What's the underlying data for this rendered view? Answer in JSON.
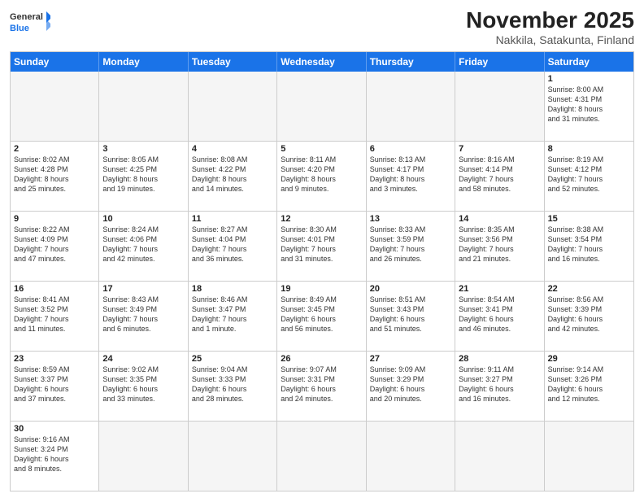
{
  "logo": {
    "general": "General",
    "blue": "Blue"
  },
  "title": "November 2025",
  "subtitle": "Nakkila, Satakunta, Finland",
  "days": [
    "Sunday",
    "Monday",
    "Tuesday",
    "Wednesday",
    "Thursday",
    "Friday",
    "Saturday"
  ],
  "rows": [
    [
      {
        "day": "",
        "info": "",
        "empty": true
      },
      {
        "day": "",
        "info": "",
        "empty": true
      },
      {
        "day": "",
        "info": "",
        "empty": true
      },
      {
        "day": "",
        "info": "",
        "empty": true
      },
      {
        "day": "",
        "info": "",
        "empty": true
      },
      {
        "day": "",
        "info": "",
        "empty": true
      },
      {
        "day": "1",
        "info": "Sunrise: 8:00 AM\nSunset: 4:31 PM\nDaylight: 8 hours\nand 31 minutes."
      }
    ],
    [
      {
        "day": "2",
        "info": "Sunrise: 8:02 AM\nSunset: 4:28 PM\nDaylight: 8 hours\nand 25 minutes."
      },
      {
        "day": "3",
        "info": "Sunrise: 8:05 AM\nSunset: 4:25 PM\nDaylight: 8 hours\nand 19 minutes."
      },
      {
        "day": "4",
        "info": "Sunrise: 8:08 AM\nSunset: 4:22 PM\nDaylight: 8 hours\nand 14 minutes."
      },
      {
        "day": "5",
        "info": "Sunrise: 8:11 AM\nSunset: 4:20 PM\nDaylight: 8 hours\nand 9 minutes."
      },
      {
        "day": "6",
        "info": "Sunrise: 8:13 AM\nSunset: 4:17 PM\nDaylight: 8 hours\nand 3 minutes."
      },
      {
        "day": "7",
        "info": "Sunrise: 8:16 AM\nSunset: 4:14 PM\nDaylight: 7 hours\nand 58 minutes."
      },
      {
        "day": "8",
        "info": "Sunrise: 8:19 AM\nSunset: 4:12 PM\nDaylight: 7 hours\nand 52 minutes."
      }
    ],
    [
      {
        "day": "9",
        "info": "Sunrise: 8:22 AM\nSunset: 4:09 PM\nDaylight: 7 hours\nand 47 minutes."
      },
      {
        "day": "10",
        "info": "Sunrise: 8:24 AM\nSunset: 4:06 PM\nDaylight: 7 hours\nand 42 minutes."
      },
      {
        "day": "11",
        "info": "Sunrise: 8:27 AM\nSunset: 4:04 PM\nDaylight: 7 hours\nand 36 minutes."
      },
      {
        "day": "12",
        "info": "Sunrise: 8:30 AM\nSunset: 4:01 PM\nDaylight: 7 hours\nand 31 minutes."
      },
      {
        "day": "13",
        "info": "Sunrise: 8:33 AM\nSunset: 3:59 PM\nDaylight: 7 hours\nand 26 minutes."
      },
      {
        "day": "14",
        "info": "Sunrise: 8:35 AM\nSunset: 3:56 PM\nDaylight: 7 hours\nand 21 minutes."
      },
      {
        "day": "15",
        "info": "Sunrise: 8:38 AM\nSunset: 3:54 PM\nDaylight: 7 hours\nand 16 minutes."
      }
    ],
    [
      {
        "day": "16",
        "info": "Sunrise: 8:41 AM\nSunset: 3:52 PM\nDaylight: 7 hours\nand 11 minutes."
      },
      {
        "day": "17",
        "info": "Sunrise: 8:43 AM\nSunset: 3:49 PM\nDaylight: 7 hours\nand 6 minutes."
      },
      {
        "day": "18",
        "info": "Sunrise: 8:46 AM\nSunset: 3:47 PM\nDaylight: 7 hours\nand 1 minute."
      },
      {
        "day": "19",
        "info": "Sunrise: 8:49 AM\nSunset: 3:45 PM\nDaylight: 6 hours\nand 56 minutes."
      },
      {
        "day": "20",
        "info": "Sunrise: 8:51 AM\nSunset: 3:43 PM\nDaylight: 6 hours\nand 51 minutes."
      },
      {
        "day": "21",
        "info": "Sunrise: 8:54 AM\nSunset: 3:41 PM\nDaylight: 6 hours\nand 46 minutes."
      },
      {
        "day": "22",
        "info": "Sunrise: 8:56 AM\nSunset: 3:39 PM\nDaylight: 6 hours\nand 42 minutes."
      }
    ],
    [
      {
        "day": "23",
        "info": "Sunrise: 8:59 AM\nSunset: 3:37 PM\nDaylight: 6 hours\nand 37 minutes."
      },
      {
        "day": "24",
        "info": "Sunrise: 9:02 AM\nSunset: 3:35 PM\nDaylight: 6 hours\nand 33 minutes."
      },
      {
        "day": "25",
        "info": "Sunrise: 9:04 AM\nSunset: 3:33 PM\nDaylight: 6 hours\nand 28 minutes."
      },
      {
        "day": "26",
        "info": "Sunrise: 9:07 AM\nSunset: 3:31 PM\nDaylight: 6 hours\nand 24 minutes."
      },
      {
        "day": "27",
        "info": "Sunrise: 9:09 AM\nSunset: 3:29 PM\nDaylight: 6 hours\nand 20 minutes."
      },
      {
        "day": "28",
        "info": "Sunrise: 9:11 AM\nSunset: 3:27 PM\nDaylight: 6 hours\nand 16 minutes."
      },
      {
        "day": "29",
        "info": "Sunrise: 9:14 AM\nSunset: 3:26 PM\nDaylight: 6 hours\nand 12 minutes."
      }
    ],
    [
      {
        "day": "30",
        "info": "Sunrise: 9:16 AM\nSunset: 3:24 PM\nDaylight: 6 hours\nand 8 minutes."
      },
      {
        "day": "",
        "info": "",
        "empty": true
      },
      {
        "day": "",
        "info": "",
        "empty": true
      },
      {
        "day": "",
        "info": "",
        "empty": true
      },
      {
        "day": "",
        "info": "",
        "empty": true
      },
      {
        "day": "",
        "info": "",
        "empty": true
      },
      {
        "day": "",
        "info": "",
        "empty": true
      }
    ]
  ]
}
